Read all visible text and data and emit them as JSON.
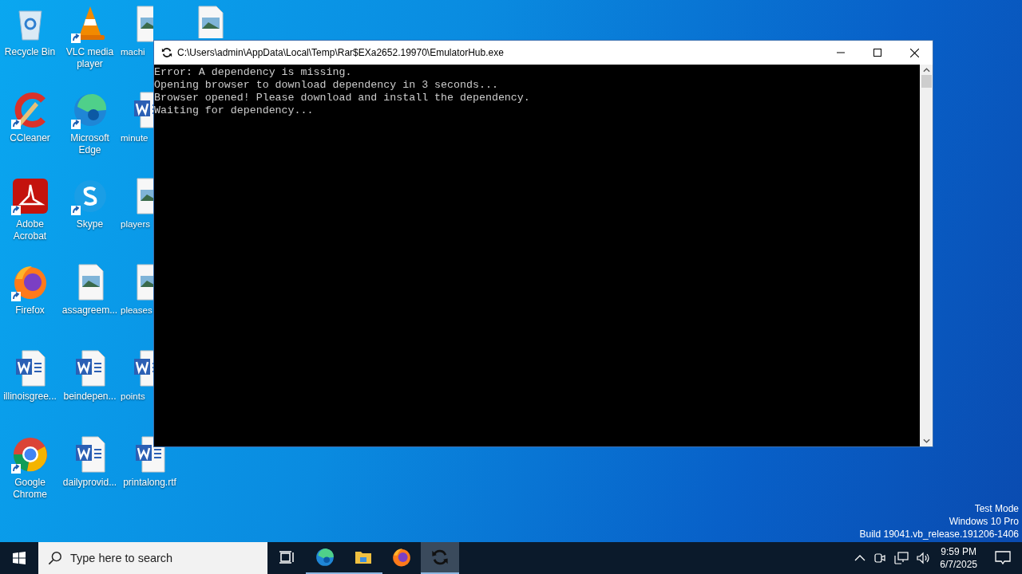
{
  "desktop": {
    "icons": [
      {
        "label": "Recycle Bin",
        "kind": "recycle",
        "shortcut": false
      },
      {
        "label": "CCleaner",
        "kind": "ccleaner",
        "shortcut": true
      },
      {
        "label": "Adobe Acrobat",
        "kind": "acrobat",
        "shortcut": true
      },
      {
        "label": "Firefox",
        "kind": "firefox",
        "shortcut": true
      },
      {
        "label": "illinoisgree...",
        "kind": "doc",
        "shortcut": false
      },
      {
        "label": "Google Chrome",
        "kind": "chrome",
        "shortcut": true
      },
      {
        "label": "VLC media player",
        "kind": "vlc",
        "shortcut": true
      },
      {
        "label": "Microsoft Edge",
        "kind": "edge",
        "shortcut": true
      },
      {
        "label": "Skype",
        "kind": "skype",
        "shortcut": true
      },
      {
        "label": "assagreem...",
        "kind": "image",
        "shortcut": false
      },
      {
        "label": "beindepen...",
        "kind": "doc",
        "shortcut": false
      },
      {
        "label": "dailyprovid...",
        "kind": "doc",
        "shortcut": false
      },
      {
        "label": "machi",
        "kind": "image",
        "shortcut": false
      },
      {
        "label": "minute",
        "kind": "doc",
        "shortcut": false
      },
      {
        "label": "players",
        "kind": "image",
        "shortcut": false
      },
      {
        "label": "pleases",
        "kind": "image",
        "shortcut": false
      },
      {
        "label": "points",
        "kind": "doc",
        "shortcut": false
      },
      {
        "label": "printalong.rtf",
        "kind": "doc",
        "shortcut": false
      },
      {
        "kind": "image",
        "shortcut": false
      }
    ],
    "watermark": [
      "Test Mode",
      "Windows 10 Pro",
      "Build 19041.vb_release.191206-1406"
    ]
  },
  "window": {
    "title": "C:\\Users\\admin\\AppData\\Local\\Temp\\Rar$EXa2652.19970\\EmulatorHub.exe",
    "console_lines": [
      "Error: A dependency is missing.",
      "Opening browser to download dependency in 3 seconds...",
      "Browser opened! Please download and install the dependency.",
      "Waiting for dependency..."
    ]
  },
  "taskbar": {
    "search": {
      "placeholder": "Type here to search"
    },
    "apps": [
      {
        "kind": "taskview",
        "running": false,
        "selected": false
      },
      {
        "kind": "edge",
        "running": true,
        "selected": false
      },
      {
        "kind": "explorer",
        "running": true,
        "selected": false
      },
      {
        "kind": "firefox",
        "running": false,
        "selected": false
      },
      {
        "kind": "console",
        "running": true,
        "selected": true
      }
    ],
    "time": "9:59 PM",
    "date": "6/7/2025"
  }
}
